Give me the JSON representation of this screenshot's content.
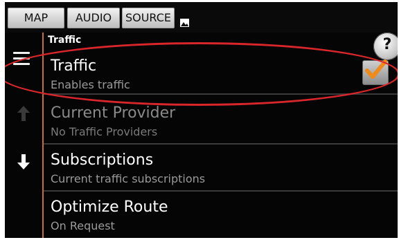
{
  "topbar": {
    "buttons": [
      "MAP",
      "AUDIO",
      "SOURCE"
    ]
  },
  "header": {
    "title": "Traffic"
  },
  "help": {
    "label": "?"
  },
  "rows": [
    {
      "title": "Traffic",
      "subtitle": "Enables traffic",
      "checked": true
    },
    {
      "title": "Current Provider",
      "subtitle": "No Traffic Providers",
      "disabled": true
    },
    {
      "title": "Subscriptions",
      "subtitle": "Current traffic subscriptions"
    },
    {
      "title": "Optimize Route",
      "subtitle": "On Request"
    }
  ],
  "colors": {
    "accent": "#f08a1c",
    "highlight": "#d8262b"
  }
}
